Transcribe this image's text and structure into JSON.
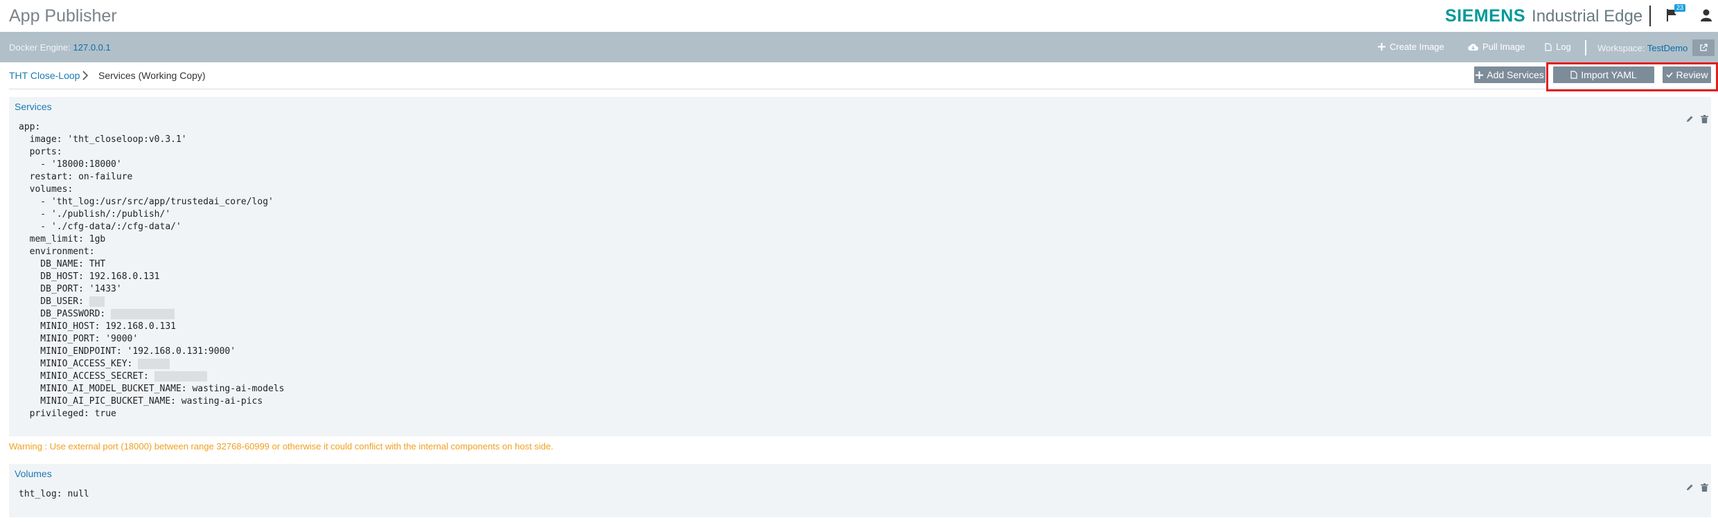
{
  "header": {
    "app_title": "App Publisher",
    "brand_siemens": "SIEMENS",
    "brand_product": "Industrial Edge",
    "notification_count": "23"
  },
  "toolbar": {
    "docker_engine_label": "Docker Engine:",
    "docker_engine_value": "127.0.0.1",
    "create_image": "Create Image",
    "pull_image": "Pull Image",
    "log": "Log",
    "workspace_label": "Workspace:",
    "workspace_value": "TestDemo"
  },
  "breadcrumb": {
    "parent": "THT Close-Loop",
    "current": "Services (Working Copy)"
  },
  "actions": {
    "add_services": "Add Services",
    "import_yaml": "Import YAML",
    "review": "Review"
  },
  "services": {
    "title": "Services",
    "lines": [
      {
        "text": "app:",
        "mask": 0
      },
      {
        "text": "  image: 'tht_closeloop:v0.3.1'",
        "mask": 0
      },
      {
        "text": "  ports:",
        "mask": 0
      },
      {
        "text": "    - '18000:18000'",
        "mask": 0
      },
      {
        "text": "  restart: on-failure",
        "mask": 0
      },
      {
        "text": "  volumes:",
        "mask": 0
      },
      {
        "text": "    - 'tht_log:/usr/src/app/trustedai_core/log'",
        "mask": 0
      },
      {
        "text": "    - './publish/:/publish/'",
        "mask": 0
      },
      {
        "text": "    - './cfg-data/:/cfg-data/'",
        "mask": 0
      },
      {
        "text": "  mem_limit: 1gb",
        "mask": 0
      },
      {
        "text": "  environment:",
        "mask": 0
      },
      {
        "text": "    DB_NAME: THT",
        "mask": 0
      },
      {
        "text": "    DB_HOST: 192.168.0.131",
        "mask": 0
      },
      {
        "text": "    DB_PORT: '1433'",
        "mask": 0
      },
      {
        "text": "    DB_USER: ",
        "mask": 22
      },
      {
        "text": "    DB_PASSWORD: ",
        "mask": 92
      },
      {
        "text": "    MINIO_HOST: 192.168.0.131",
        "mask": 0
      },
      {
        "text": "    MINIO_PORT: '9000'",
        "mask": 0
      },
      {
        "text": "    MINIO_ENDPOINT: '192.168.0.131:9000'",
        "mask": 0
      },
      {
        "text": "    MINIO_ACCESS_KEY: ",
        "mask": 46
      },
      {
        "text": "    MINIO_ACCESS_SECRET: ",
        "mask": 76
      },
      {
        "text": "    MINIO_AI_MODEL_BUCKET_NAME: wasting-ai-models",
        "mask": 0
      },
      {
        "text": "    MINIO_AI_PIC_BUCKET_NAME: wasting-ai-pics",
        "mask": 0
      },
      {
        "text": "  privileged: true",
        "mask": 0
      }
    ]
  },
  "warning": "Warning : Use external port (18000) between range 32768-60999 or otherwise it could conflict with the internal components on host side.",
  "volumes": {
    "title": "Volumes",
    "lines": [
      {
        "text": "tht_log: null",
        "mask": 0
      }
    ]
  },
  "colors": {
    "brand": "#009999",
    "toolbar_bg": "#b1bfc9",
    "link": "#1a7bb3",
    "button_dark": "#7d8c99",
    "warning": "#f0a020",
    "highlight": "#e02020"
  }
}
